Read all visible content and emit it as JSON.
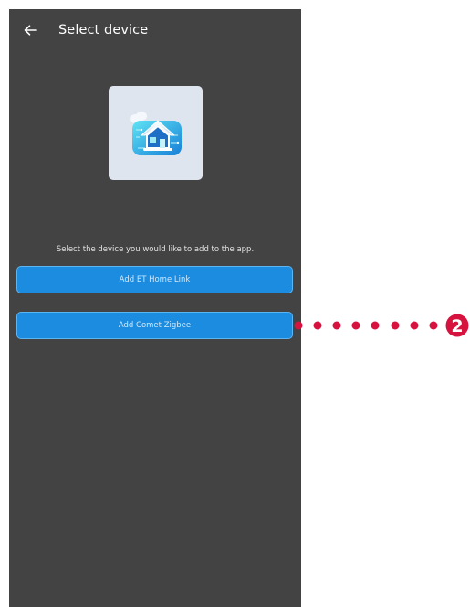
{
  "header": {
    "title": "Select device"
  },
  "main": {
    "instruction": "Select the device you would like to add to the app.",
    "buttons": {
      "add_home_link": "Add ET Home Link",
      "add_comet_zigbee": "Add Comet Zigbee"
    }
  },
  "annotation": {
    "step_number": "2",
    "color": "#d6123f"
  },
  "colors": {
    "screen_background": "#434343",
    "button_blue": "#1b8ce0",
    "button_border": "#5cb4f2",
    "card_background": "#dfe5ef"
  },
  "icons": {
    "back": "arrow-left-icon",
    "device": "smart-home-icon"
  }
}
